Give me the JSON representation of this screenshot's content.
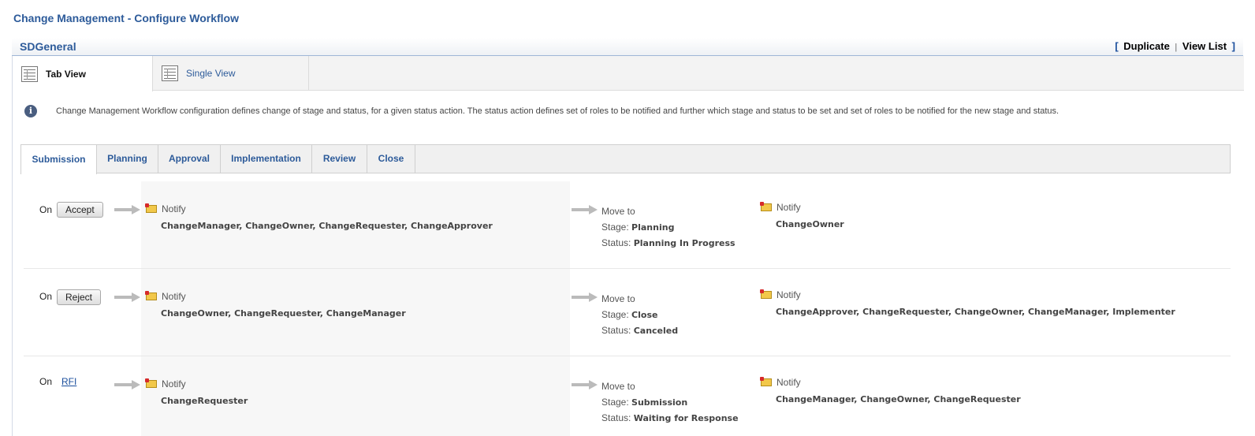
{
  "page_title": "Change Management - Configure Workflow",
  "template": {
    "name": "SDGeneral",
    "links": {
      "open_bracket": "[",
      "duplicate": "Duplicate",
      "separator": "|",
      "view_list": "View List",
      "close_bracket": "]"
    }
  },
  "view_tabs": [
    {
      "label": "Tab View",
      "icon": "grid-icon",
      "active": true
    },
    {
      "label": "Single View",
      "icon": "grid-icon",
      "active": false
    }
  ],
  "info": {
    "icon": "info-icon",
    "text": "Change Management Workflow configuration defines change of stage and status, for a given status action. The status action defines set of roles to be notified and further which stage and status to be set and set of roles to be notified for the new stage and status."
  },
  "stage_tabs": [
    {
      "label": "Submission",
      "active": true
    },
    {
      "label": "Planning",
      "active": false
    },
    {
      "label": "Approval",
      "active": false
    },
    {
      "label": "Implementation",
      "active": false
    },
    {
      "label": "Review",
      "active": false
    },
    {
      "label": "Close",
      "active": false
    }
  ],
  "labels": {
    "on": "On",
    "notify": "Notify",
    "move_to": "Move to",
    "stage": "Stage:",
    "status": "Status:"
  },
  "rules": [
    {
      "action": "Accept",
      "action_type": "button",
      "notify_before": "ChangeManager, ChangeOwner, ChangeRequester, ChangeApprover",
      "stage": "Planning",
      "status": "Planning In Progress",
      "notify_after": "ChangeOwner"
    },
    {
      "action": "Reject",
      "action_type": "button",
      "notify_before": "ChangeOwner, ChangeRequester, ChangeManager",
      "stage": "Close",
      "status": "Canceled",
      "notify_after": "ChangeApprover, ChangeRequester, ChangeOwner, ChangeManager, Implementer"
    },
    {
      "action": "RFI",
      "action_type": "link",
      "notify_before": "ChangeRequester",
      "stage": "Submission",
      "status": "Waiting for Response",
      "notify_after": "ChangeManager, ChangeOwner, ChangeRequester"
    }
  ],
  "colors": {
    "accent": "#2d5b9a",
    "link": "#1a4e9c",
    "notify_bg": "#f7f7f7"
  }
}
